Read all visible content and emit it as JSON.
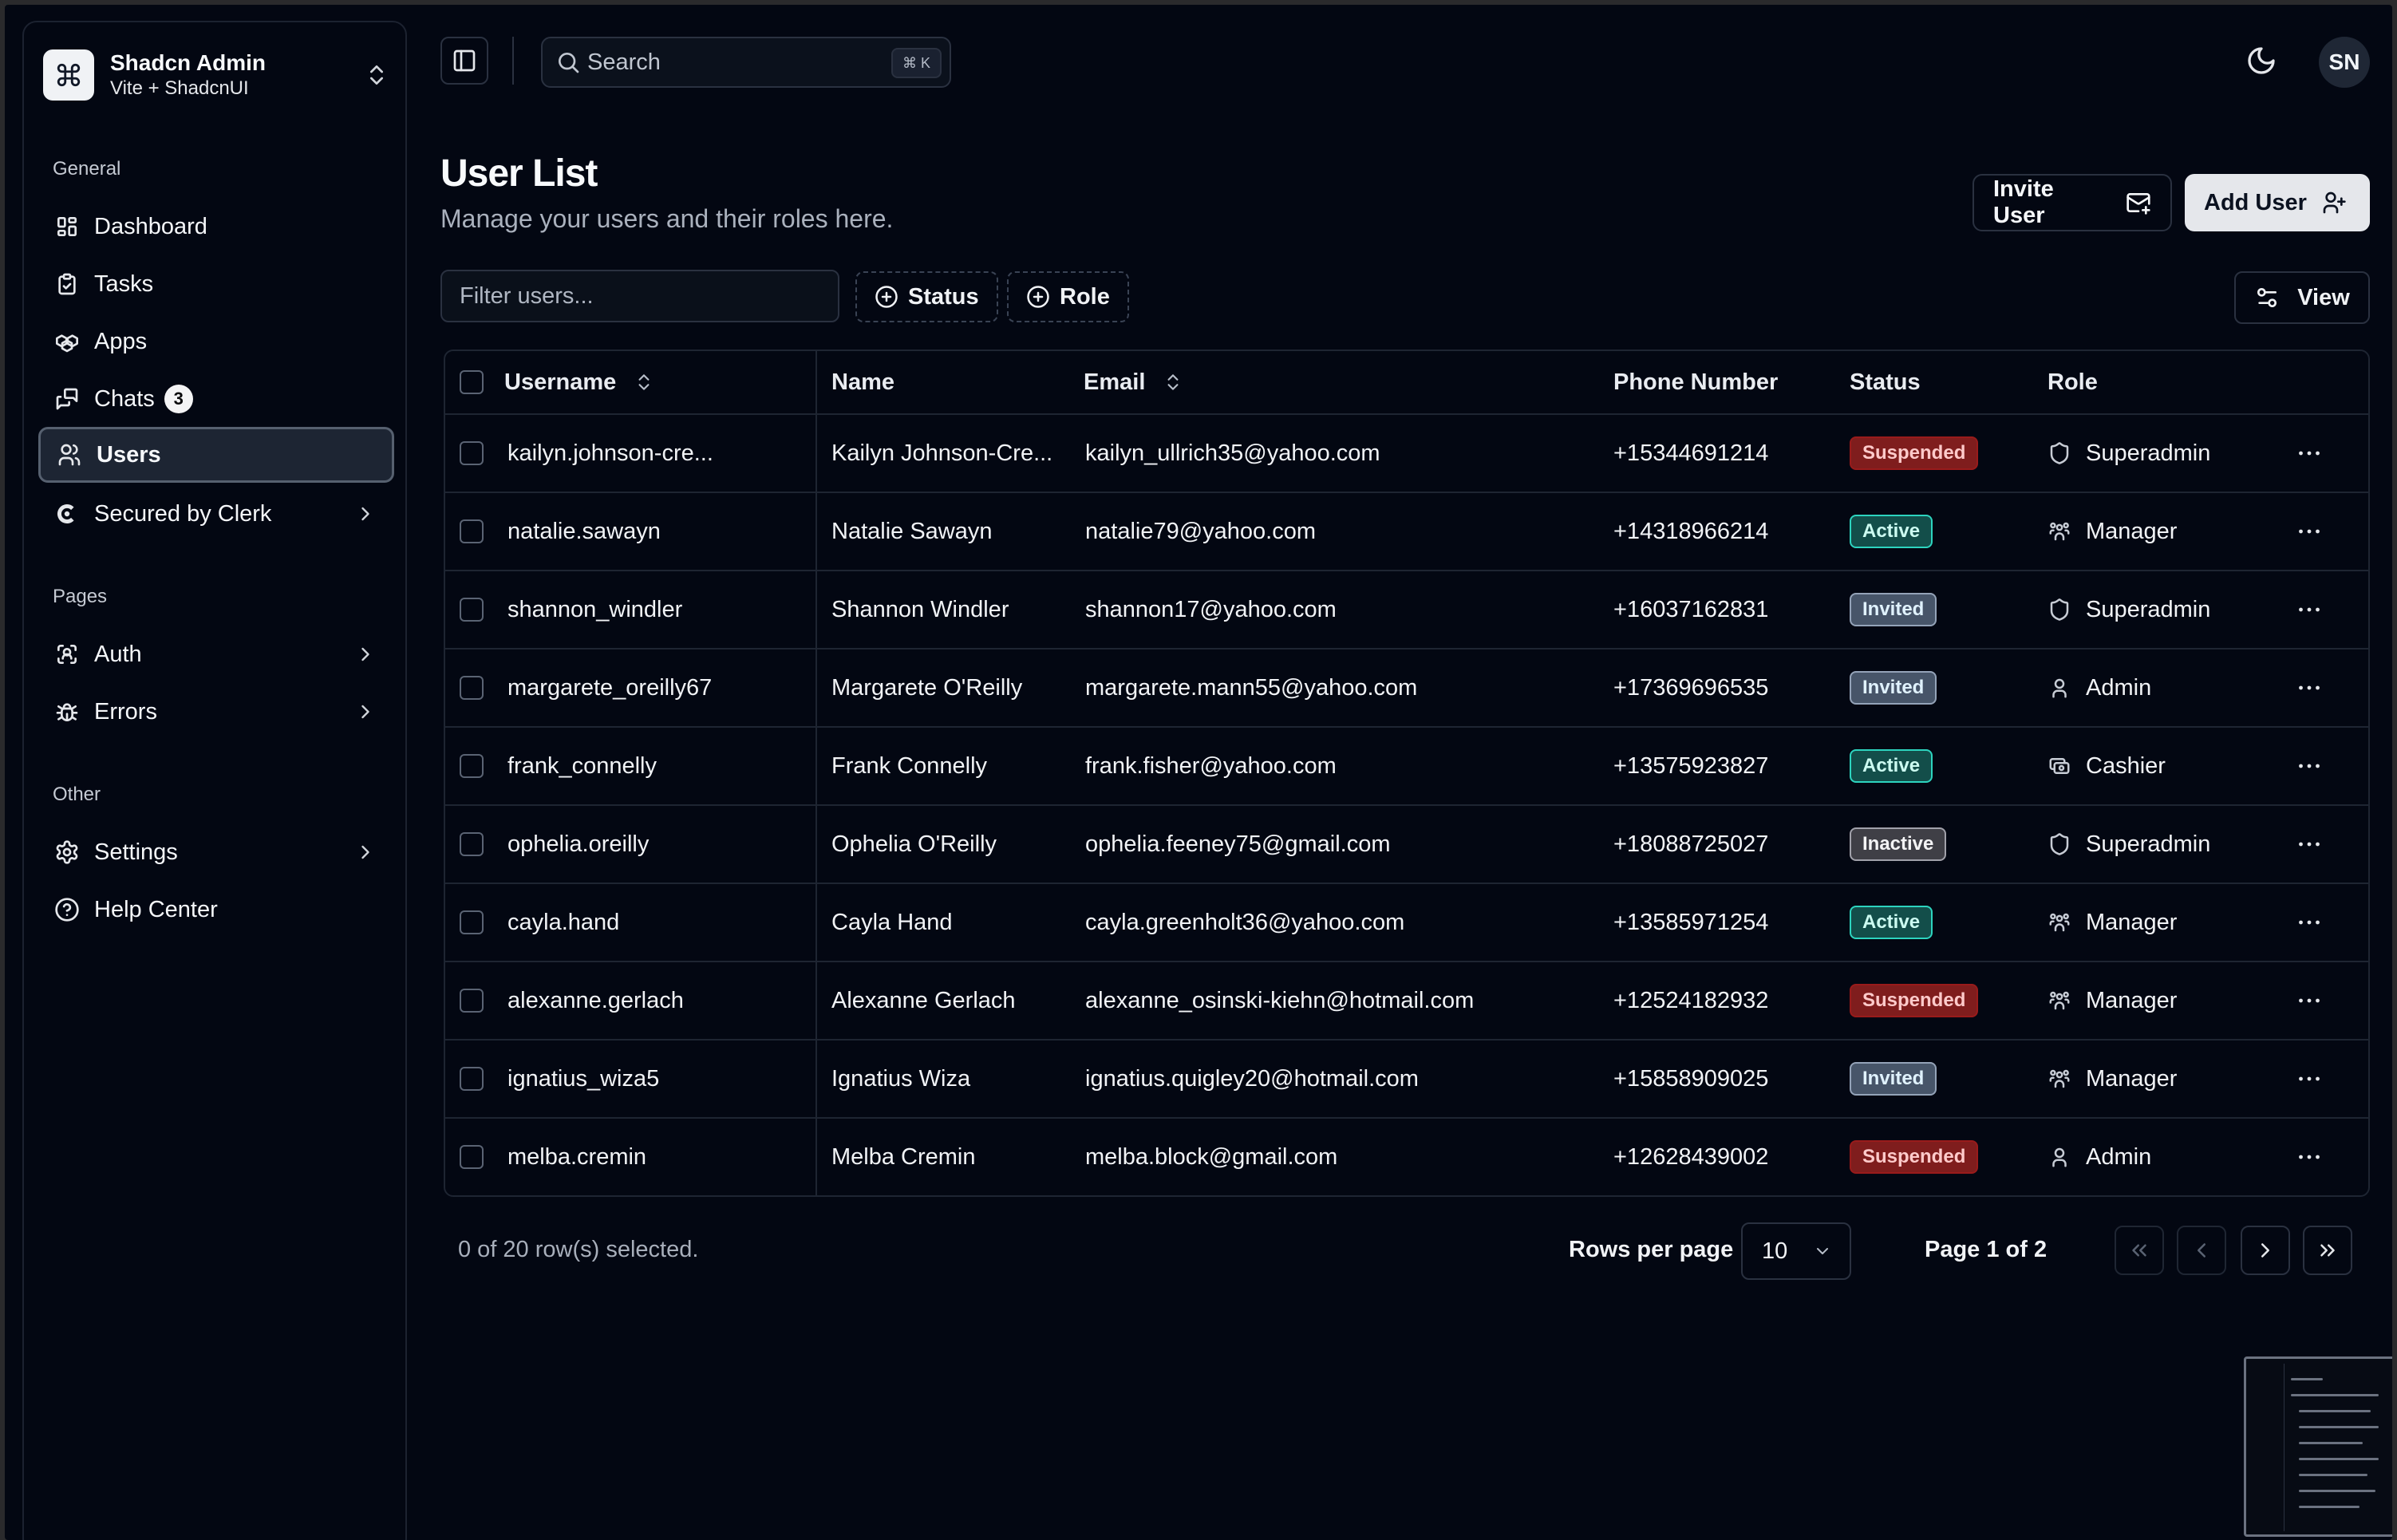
{
  "team": {
    "name": "Shadcn Admin",
    "subtitle": "Vite + ShadcnUI"
  },
  "sidebar": {
    "groups": [
      {
        "label": "General"
      },
      {
        "label": "Pages"
      },
      {
        "label": "Other"
      }
    ],
    "items": [
      {
        "label": "Dashboard",
        "icon": "layout-dashboard-icon"
      },
      {
        "label": "Tasks",
        "icon": "checklist-icon"
      },
      {
        "label": "Apps",
        "icon": "packages-icon"
      },
      {
        "label": "Chats",
        "icon": "messages-icon",
        "badge": "3"
      },
      {
        "label": "Users",
        "icon": "users-icon",
        "active": true
      },
      {
        "label": "Secured by Clerk",
        "icon": "clerk-icon"
      },
      {
        "label": "Auth",
        "icon": "user-scan-icon"
      },
      {
        "label": "Errors",
        "icon": "bug-icon"
      },
      {
        "label": "Settings",
        "icon": "settings-icon"
      },
      {
        "label": "Help Center",
        "icon": "help-icon"
      }
    ]
  },
  "header": {
    "search_placeholder": "Search",
    "shortcut": "⌘ K",
    "avatar_initials": "SN"
  },
  "page": {
    "title": "User List",
    "description": "Manage your users and their roles here.",
    "invite_label": "Invite User",
    "add_label": "Add User"
  },
  "toolbar": {
    "filter_placeholder": "Filter users...",
    "status_label": "Status",
    "role_label": "Role",
    "view_label": "View"
  },
  "table": {
    "headers": {
      "username": "Username",
      "name": "Name",
      "email": "Email",
      "phone": "Phone Number",
      "status": "Status",
      "role": "Role"
    },
    "rows": [
      {
        "username": "kailyn.johnson-cre...",
        "name": "Kailyn Johnson-Cre...",
        "email": "kailyn_ullrich35@yahoo.com",
        "phone": "+15344691214",
        "status": "Suspended",
        "role": "Superadmin"
      },
      {
        "username": "natalie.sawayn",
        "name": "Natalie Sawayn",
        "email": "natalie79@yahoo.com",
        "phone": "+14318966214",
        "status": "Active",
        "role": "Manager"
      },
      {
        "username": "shannon_windler",
        "name": "Shannon Windler",
        "email": "shannon17@yahoo.com",
        "phone": "+16037162831",
        "status": "Invited",
        "role": "Superadmin"
      },
      {
        "username": "margarete_oreilly67",
        "name": "Margarete O'Reilly",
        "email": "margarete.mann55@yahoo.com",
        "phone": "+17369696535",
        "status": "Invited",
        "role": "Admin"
      },
      {
        "username": "frank_connelly",
        "name": "Frank Connelly",
        "email": "frank.fisher@yahoo.com",
        "phone": "+13575923827",
        "status": "Active",
        "role": "Cashier"
      },
      {
        "username": "ophelia.oreilly",
        "name": "Ophelia O'Reilly",
        "email": "ophelia.feeney75@gmail.com",
        "phone": "+18088725027",
        "status": "Inactive",
        "role": "Superadmin"
      },
      {
        "username": "cayla.hand",
        "name": "Cayla Hand",
        "email": "cayla.greenholt36@yahoo.com",
        "phone": "+13585971254",
        "status": "Active",
        "role": "Manager"
      },
      {
        "username": "alexanne.gerlach",
        "name": "Alexanne Gerlach",
        "email": "alexanne_osinski-kiehn@hotmail.com",
        "phone": "+12524182932",
        "status": "Suspended",
        "role": "Manager"
      },
      {
        "username": "ignatius_wiza5",
        "name": "Ignatius Wiza",
        "email": "ignatius.quigley20@hotmail.com",
        "phone": "+15858909025",
        "status": "Invited",
        "role": "Manager"
      },
      {
        "username": "melba.cremin",
        "name": "Melba Cremin",
        "email": "melba.block@gmail.com",
        "phone": "+12628439002",
        "status": "Suspended",
        "role": "Admin"
      }
    ]
  },
  "footer": {
    "selection_text": "0 of 20 row(s) selected.",
    "rows_per_page_label": "Rows per page",
    "rows_per_page_value": "10",
    "page_indicator": "Page 1 of 2"
  },
  "colors": {
    "background": "#030712",
    "suspended_bg": "#7f1d1d",
    "active_bg": "#134e4a",
    "invited_bg": "#475569",
    "inactive_bg": "#3f3f46"
  }
}
